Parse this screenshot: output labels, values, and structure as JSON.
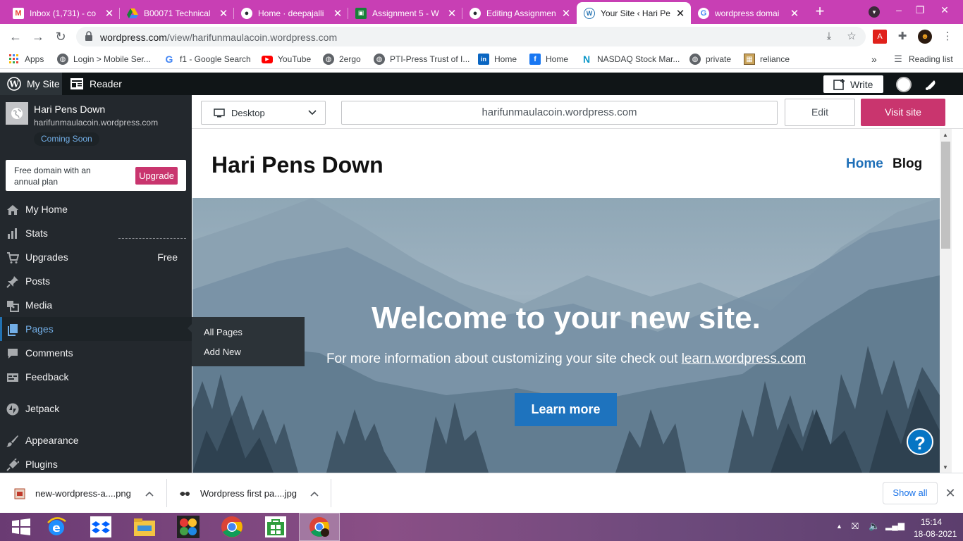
{
  "browser": {
    "tabs": [
      {
        "title": "Inbox (1,731) - co",
        "icon": "gmail-icon",
        "color": "#ea4335"
      },
      {
        "title": "B00071 Technical",
        "icon": "drive-icon",
        "color": "#fbbc04"
      },
      {
        "title": "Home · deepajalli",
        "icon": "github-icon",
        "color": "#ffffff"
      },
      {
        "title": "Assignment 5 - W",
        "icon": "classroom-icon",
        "color": "#188038"
      },
      {
        "title": "Editing Assignmen",
        "icon": "github-icon",
        "color": "#ffffff"
      },
      {
        "title": "Your Site ‹ Hari Pe",
        "icon": "wordpress-icon",
        "color": "#2271b1",
        "active": true
      },
      {
        "title": "wordpress domai",
        "icon": "google-icon",
        "color": "#4285f4"
      }
    ],
    "url_host": "wordpress.com",
    "url_path": "/view/harifunmaulacoin.wordpress.com",
    "bookmarks": [
      {
        "label": "Apps",
        "icon": "apps-grid-icon"
      },
      {
        "label": "Login > Mobile Ser...",
        "icon": "globe-icon"
      },
      {
        "label": "f1 - Google Search",
        "icon": "google-icon"
      },
      {
        "label": "YouTube",
        "icon": "youtube-icon"
      },
      {
        "label": "2ergo",
        "icon": "globe-icon"
      },
      {
        "label": "PTI-Press Trust of I...",
        "icon": "globe-icon"
      },
      {
        "label": "Home",
        "icon": "linkedin-icon"
      },
      {
        "label": "Home",
        "icon": "facebook-icon"
      },
      {
        "label": "NASDAQ Stock Mar...",
        "icon": "nasdaq-icon"
      },
      {
        "label": "private",
        "icon": "globe-icon"
      },
      {
        "label": "reliance",
        "icon": "image-icon"
      }
    ],
    "bookmarks_overflow": "»",
    "reading_list": "Reading list"
  },
  "masterbar": {
    "my_site": "My Site",
    "reader": "Reader",
    "write": "Write"
  },
  "sidebar": {
    "site_name": "Hari Pens Down",
    "site_url": "harifunmaulacoin.wordpress.com",
    "badge": "Coming Soon",
    "upsell_text": "Free domain with an annual plan",
    "upsell_button": "Upgrade",
    "items": [
      {
        "label": "My Home",
        "icon": "home-icon"
      },
      {
        "label": "Stats",
        "icon": "stats-icon"
      },
      {
        "label": "Upgrades",
        "icon": "cart-icon",
        "badge": "Free"
      },
      {
        "label": "Posts",
        "icon": "pin-icon"
      },
      {
        "label": "Media",
        "icon": "media-icon"
      },
      {
        "label": "Pages",
        "icon": "pages-icon",
        "selected": true
      },
      {
        "label": "Comments",
        "icon": "comment-icon"
      },
      {
        "label": "Feedback",
        "icon": "feedback-icon"
      },
      {
        "label": "Jetpack",
        "icon": "jetpack-icon"
      },
      {
        "label": "Appearance",
        "icon": "brush-icon"
      },
      {
        "label": "Plugins",
        "icon": "plugin-icon"
      }
    ],
    "flyout": [
      "All Pages",
      "Add New"
    ]
  },
  "preview": {
    "device": "Desktop",
    "url": "harifunmaulacoin.wordpress.com",
    "edit": "Edit",
    "visit": "Visit site"
  },
  "site": {
    "title": "Hari Pens Down",
    "nav": [
      "Home",
      "Blog"
    ],
    "hero_title": "Welcome to your new site.",
    "hero_sub_prefix": "For more information about customizing your site check out ",
    "hero_sub_link": "learn.wordpress.com",
    "hero_button": "Learn more",
    "help": "?"
  },
  "downloads": {
    "items": [
      "new-wordpress-a....png",
      "Wordpress first pa....jpg"
    ],
    "show_all": "Show all",
    "close": "✕"
  },
  "taskbar": {
    "time": "15:14",
    "date": "18-08-2021"
  },
  "colors": {
    "tabstrip": "#c83fb4",
    "wp_pink": "#c9356e",
    "wp_blue": "#2271b1",
    "sidebar": "#23282d"
  }
}
